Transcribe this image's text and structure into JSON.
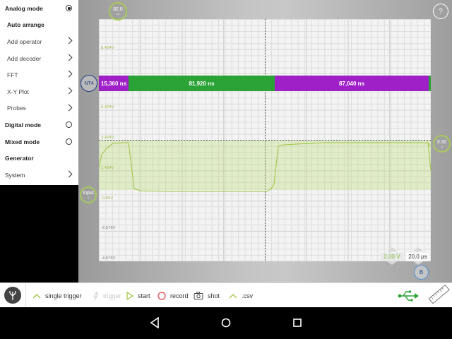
{
  "sidebar": {
    "items": [
      {
        "label": "Analog mode",
        "style": "bold",
        "control": "radio",
        "selected": true
      },
      {
        "label": "Auto arrange",
        "style": "bold",
        "control": "none"
      },
      {
        "label": "Add operator",
        "style": "sub",
        "control": "chevron"
      },
      {
        "label": "Add decoder",
        "style": "sub",
        "control": "chevron"
      },
      {
        "label": "FFT",
        "style": "sub",
        "control": "chevron"
      },
      {
        "label": "X-Y Plot",
        "style": "sub",
        "control": "chevron"
      },
      {
        "label": "Probes",
        "style": "sub",
        "control": "chevron"
      },
      {
        "label": "Digital mode",
        "style": "bold",
        "control": "radio",
        "selected": false
      },
      {
        "label": "Mixed mode",
        "style": "bold",
        "control": "radio",
        "selected": false
      },
      {
        "label": "Generator",
        "style": "bold",
        "control": "none"
      },
      {
        "label": "System",
        "style": "plain",
        "control": "chevron"
      }
    ]
  },
  "scope": {
    "trigger_marker": {
      "value": "82.0",
      "unit": "us"
    },
    "help_label": "?",
    "channel_marker": "NT4",
    "input_marker": {
      "label": "Input",
      "sub": "1"
    },
    "level_marker": {
      "value": "3.32",
      "unit": "V"
    },
    "b_marker": "B",
    "volt_labels": [
      "8.424V",
      "5.424V",
      "3.424V",
      "1.424V",
      "-0.56V",
      "-2.576V",
      "-4.576V"
    ],
    "decoder_segments": [
      {
        "label": "15,360 ns",
        "color": "#a020c8"
      },
      {
        "label": "81,920 ns",
        "color": "#2aa236"
      },
      {
        "label": "87,040 ns",
        "color": "#a020c8"
      }
    ],
    "volt_scale": "2.00 V",
    "time_scale": "20.0 μs",
    "accent_color": "#9cc43c"
  },
  "toolbar": {
    "single_trigger": "single trigger",
    "trigger": "trigger",
    "start": "start",
    "record": "record",
    "shot": "shot",
    "csv": ".csv"
  }
}
